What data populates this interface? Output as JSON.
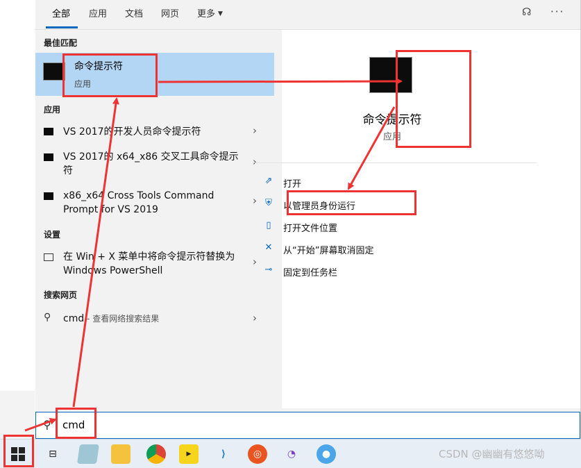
{
  "tabs": [
    {
      "label": "全部",
      "active": true
    },
    {
      "label": "应用"
    },
    {
      "label": "文档"
    },
    {
      "label": "网页"
    },
    {
      "label": "更多"
    }
  ],
  "top_icons": [
    "feedback-icon",
    "more-options-icon"
  ],
  "sections": {
    "best_match": "最佳匹配",
    "apps": "应用",
    "settings": "设置",
    "web": "搜索网页"
  },
  "best_match": {
    "title": "命令提示符",
    "subtitle": "应用"
  },
  "app_items": [
    {
      "label": "VS 2017的开发人员命令提示符"
    },
    {
      "label": "VS 2017的 x64_x86 交叉工具命令提示符"
    },
    {
      "label": "x86_x64 Cross Tools Command Prompt for VS 2019"
    }
  ],
  "settings_items": [
    {
      "label": "在 Win + X 菜单中将命令提示符替换为 Windows PowerShell"
    }
  ],
  "web_item": {
    "query": "cmd",
    "suffix": " - 查看网络搜索结果"
  },
  "preview": {
    "title": "命令提示符",
    "subtitle": "应用"
  },
  "actions": [
    {
      "label": "打开",
      "icon": "open-icon"
    },
    {
      "label": "以管理员身份运行",
      "icon": "shield-icon"
    },
    {
      "label": "打开文件位置",
      "icon": "folder-icon"
    },
    {
      "label": "从“开始”屏幕取消固定",
      "icon": "unpin-icon"
    },
    {
      "label": "固定到任务栏",
      "icon": "pin-icon"
    }
  ],
  "search": {
    "value": "cmd"
  },
  "taskbar": {
    "apps": [
      "task-view-icon",
      "notepad-icon",
      "file-explorer-icon",
      "chrome-icon",
      "video-player-icon",
      "vscode-icon",
      "ubuntu-icon",
      "app-icon",
      "browser-icon"
    ]
  },
  "watermark": "CSDN @幽幽有悠悠呦",
  "colors": {
    "accent": "#0067c0",
    "highlight": "#b3d6f5",
    "annotation": "#ee3333"
  }
}
